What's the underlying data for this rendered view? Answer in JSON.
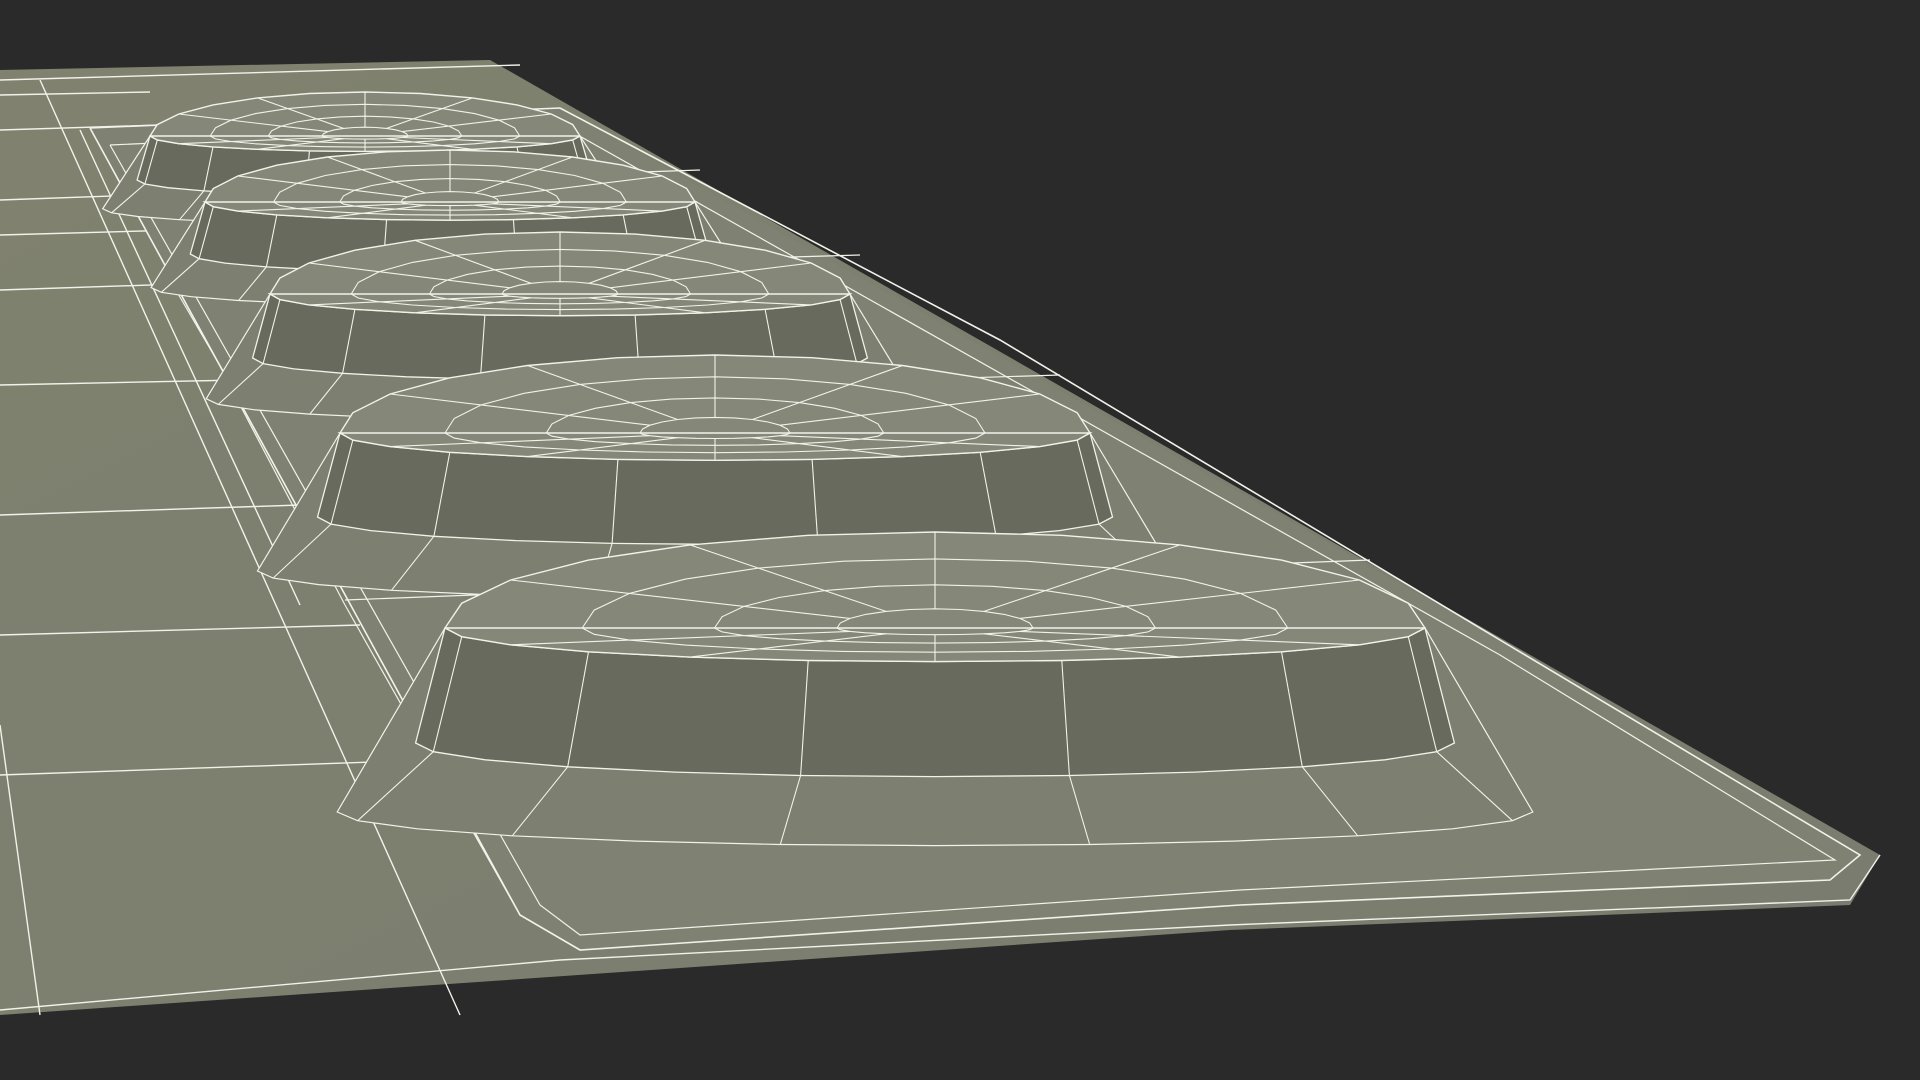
{
  "scene": {
    "subject": "blister-pack-wireframe-render",
    "background_color": "#2a2a2a",
    "surface_color": "#7d7f71",
    "surface_top_color": "#858778",
    "surface_side_color": "#676a5d",
    "shadow_color": "#595b50",
    "wire_color": "#f2f2ea",
    "blister_count": 5
  }
}
